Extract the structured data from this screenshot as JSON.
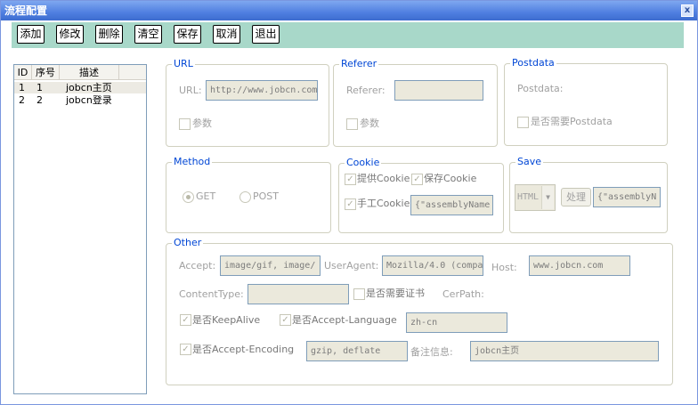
{
  "window": {
    "title": "流程配置",
    "close_glyph": "x"
  },
  "toolbar": {
    "add": "添加",
    "edit": "修改",
    "delete": "删除",
    "clear": "清空",
    "save": "保存",
    "cancel": "取消",
    "exit": "退出"
  },
  "list": {
    "headers": [
      "ID",
      "序号",
      "描述"
    ],
    "rows": [
      {
        "id": "1",
        "seq": "1",
        "desc": "jobcn主页",
        "selected": true
      },
      {
        "id": "2",
        "seq": "2",
        "desc": "jobcn登录",
        "selected": false
      }
    ]
  },
  "url_group": {
    "title": "URL",
    "url_label": "URL:",
    "url_value": "http://www.jobcn.com",
    "param_label": "参数"
  },
  "referer_group": {
    "title": "Referer",
    "referer_label": "Referer:",
    "referer_value": "",
    "param_label": "参数"
  },
  "postdata_group": {
    "title": "Postdata",
    "postdata_label": "Postdata:",
    "need_label": "是否需要Postdata"
  },
  "method_group": {
    "title": "Method",
    "get_label": "GET",
    "post_label": "POST",
    "selected": "GET"
  },
  "cookie_group": {
    "title": "Cookie",
    "provide_label": "提供Cookie",
    "save_label": "保存Cookie",
    "manual_label": "手工Cookie",
    "manual_value": "{\"assemblyName"
  },
  "save_group": {
    "title": "Save",
    "format_value": "HTML",
    "process_label": "处理",
    "process_value": "{\"assemblyN"
  },
  "other_group": {
    "title": "Other",
    "accept_label": "Accept:",
    "accept_value": "image/gif, image/",
    "useragent_label": "UserAgent:",
    "useragent_value": "Mozilla/4.0 (compa",
    "host_label": "Host:",
    "host_value": "www.jobcn.com",
    "contenttype_label": "ContentType:",
    "contenttype_value": "",
    "need_cert_label": "是否需要证书",
    "cerpath_label": "CerPath:",
    "keepalive_label": "是否KeepAlive",
    "accept_language_label": "是否Accept-Language",
    "accept_language_value": "zh-cn",
    "accept_encoding_label": "是否Accept-Encoding",
    "accept_encoding_value": "gzip, deflate",
    "remark_label": "备注信息:",
    "remark_value": "jobcn主页"
  }
}
